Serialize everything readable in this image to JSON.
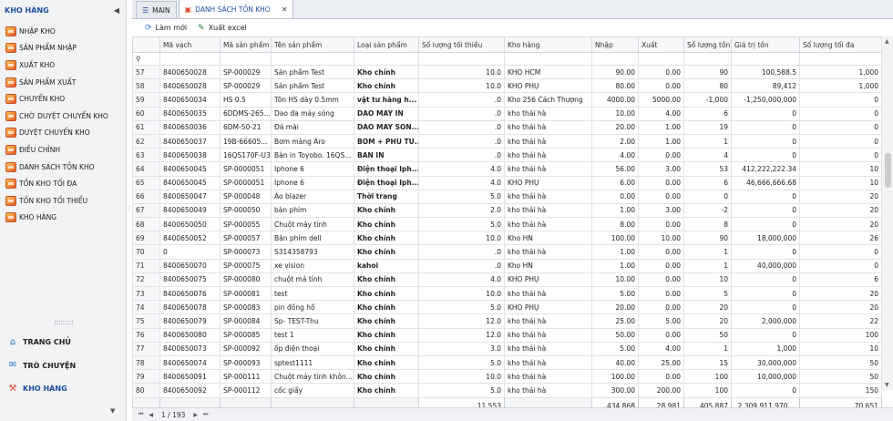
{
  "sidebar": {
    "title": "KHO HÀNG",
    "items": [
      {
        "label": "NHẬP KHO"
      },
      {
        "label": "SẢN PHẨM NHẬP"
      },
      {
        "label": "XUẤT KHO"
      },
      {
        "label": "SẢN PHẨM XUẤT"
      },
      {
        "label": "CHUYỂN KHO"
      },
      {
        "label": "CHỜ DUYỆT CHUYỂN KHO"
      },
      {
        "label": "DUYỆT CHUYỂN KHO"
      },
      {
        "label": "ĐIỀU CHỈNH"
      },
      {
        "label": "DANH SÁCH TỒN KHO"
      },
      {
        "label": "TỒN KHO TỐI ĐA"
      },
      {
        "label": "TỒN KHO TỐI THIỂU"
      },
      {
        "label": "KHO HÀNG"
      }
    ],
    "bottom": [
      {
        "label": "TRANG CHỦ",
        "icon": "home-icon"
      },
      {
        "label": "TRÒ CHUYỆN",
        "icon": "chat-icon"
      },
      {
        "label": "KHO HÀNG",
        "icon": "warehouse-icon"
      }
    ]
  },
  "tabs": [
    {
      "label": "MAIN",
      "icon": "list-icon"
    },
    {
      "label": "DANH SÁCH TỒN KHO",
      "icon": "report-icon"
    }
  ],
  "toolbar": {
    "refresh_label": "Làm mới",
    "export_label": "Xuất excel"
  },
  "columns": [
    "",
    "Mã vạch",
    "Mã sản phẩm",
    "Tên sản phẩm",
    "Loại sản phẩm",
    "Số lượng tối thiểu",
    "Kho hàng",
    "Nhập",
    "Xuất",
    "Số lượng tồn",
    "Giá trị tồn",
    "Số lượng tối đa"
  ],
  "filter_icon": "filter-icon",
  "rows": [
    [
      "57",
      "8400650028",
      "SP-000029",
      "Sản phẩm Test",
      "Kho chính",
      "10.0",
      "KHO HCM",
      "90.00",
      "0.00",
      "90",
      "100,588.5",
      "1,000"
    ],
    [
      "58",
      "8400650028",
      "SP-000029",
      "Sản phẩm Test",
      "Kho chính",
      "10.0",
      "KHO PHỤ",
      "80.00",
      "0.00",
      "80",
      "89,412",
      "1,000"
    ],
    [
      "59",
      "8400650034",
      "HS 0.5",
      "Tôn HS dày 0.5mm",
      "vật tư hàng h...",
      ".0",
      "Kho 256 Cách Thượng",
      "4000.00",
      "5000.00",
      "-1,000",
      "-1,250,000,000",
      "0"
    ],
    [
      "60",
      "8400650035",
      "6DDMS-265...",
      "Dao đa máy sóng",
      "DAO MAY IN",
      ".0",
      "kho thái hà",
      "10.00",
      "4.00",
      "6",
      "0",
      "0"
    ],
    [
      "61",
      "8400650036",
      "6DM-50-21",
      "Đá mài",
      "DAO MAY SON...",
      ".0",
      "kho thái hà",
      "20.00",
      "1.00",
      "19",
      "0",
      "0"
    ],
    [
      "62",
      "8400650037",
      "19B-66605...",
      "Bơm màng Aro",
      "BOM + PHU TU...",
      ".0",
      "kho thái hà",
      "2.00",
      "1.00",
      "1",
      "0",
      "0"
    ],
    [
      "63",
      "8400650038",
      "16QS170F-U3",
      "Bàn in Toyobo. 16QS...",
      "BAN IN",
      ".0",
      "kho thái hà",
      "4.00",
      "0.00",
      "4",
      "0",
      "0"
    ],
    [
      "64",
      "8400650045",
      "SP-0000051",
      "Iphone 6",
      "Điện thoại Iph...",
      "4.0",
      "kho thái hà",
      "56.00",
      "3.00",
      "53",
      "412,222,222.34",
      "10"
    ],
    [
      "65",
      "8400650045",
      "SP-0000051",
      "Iphone 6",
      "Điện thoại Iph...",
      "4.0",
      "KHO PHỤ",
      "6.00",
      "0.00",
      "6",
      "46,666,666.68",
      "10"
    ],
    [
      "66",
      "8400650047",
      "SP-000048",
      "Áo blazer",
      "Thời trang",
      "5.0",
      "kho thái hà",
      "0.00",
      "0.00",
      "0",
      "0",
      "20"
    ],
    [
      "67",
      "8400650049",
      "SP-000050",
      "bàn  phím",
      "Kho chính",
      "2.0",
      "kho thái hà",
      "1.00",
      "3.00",
      "-2",
      "0",
      "20"
    ],
    [
      "68",
      "8400650050",
      "SP-000055",
      "Chuột máy tính",
      "Kho chính",
      "5.0",
      "kho thái hà",
      "8.00",
      "0.00",
      "8",
      "0",
      "20"
    ],
    [
      "69",
      "8400650052",
      "SP-000057",
      "Bàn phím dell",
      "Kho chính",
      "10.0",
      "Kho HN",
      "100.00",
      "10.00",
      "90",
      "18,000,000",
      "26"
    ],
    [
      "70",
      "0",
      "SP-000073",
      "S314358793",
      "Kho chính",
      ".0",
      "kho thái hà",
      "1.00",
      "0.00",
      "1",
      "0",
      "0"
    ],
    [
      "71",
      "8400650070",
      "SP-000075",
      "xe vision",
      "kahoi",
      ".0",
      "Kho HN",
      "1.00",
      "0.00",
      "1",
      "40,000,000",
      "0"
    ],
    [
      "72",
      "8400650075",
      "SP-000080",
      "chuột mả tính",
      "Kho chính",
      "4.0",
      "KHO PHỤ",
      "10.00",
      "0.00",
      "10",
      "0",
      "6"
    ],
    [
      "73",
      "8400650076",
      "SP-000081",
      "test",
      "Kho chính",
      "10.0",
      "kho thái hà",
      "5.00",
      "0.00",
      "5",
      "0",
      "20"
    ],
    [
      "74",
      "8400650078",
      "SP-000083",
      "pin đồng hồ",
      "Kho chính",
      "5.0",
      "KHO PHỤ",
      "20.00",
      "0.00",
      "20",
      "0",
      "20"
    ],
    [
      "75",
      "8400650079",
      "SP-000084",
      "Sp- TEST-Thu",
      "Kho chính",
      "12.0",
      "kho thái hà",
      "25.00",
      "5.00",
      "20",
      "2,000,000",
      "22"
    ],
    [
      "76",
      "8400650080",
      "SP-000085",
      "test 1",
      "Kho chính",
      "12.0",
      "kho thái hà",
      "50.00",
      "0.00",
      "50",
      "0",
      "100"
    ],
    [
      "77",
      "8400650073",
      "SP-000092",
      "ốp điện thoại",
      "Kho chính",
      "3.0",
      "kho thái hà",
      "5.00",
      "4.00",
      "1",
      "1,000",
      "10"
    ],
    [
      "78",
      "8400650074",
      "SP-000093",
      "sptest1111",
      "Kho chính",
      "5.0",
      "kho thái hà",
      "40.00",
      "25.00",
      "15",
      "30,000,000",
      "50"
    ],
    [
      "79",
      "8400650091",
      "SP-000111",
      "Chuột máy tính  khôn...",
      "Kho chính",
      "10.0",
      "kho thái hà",
      "100.00",
      "0.00",
      "100",
      "10,000,000",
      "50"
    ]
  ],
  "partial_row": [
    "80",
    "8400650092",
    "SP-000112",
    "cốc giấy",
    "Kho chính",
    "5.0",
    "kho thái hà",
    "300.00",
    "200.00",
    "100",
    "0",
    "150"
  ],
  "summary": {
    "min_qty": "11,553",
    "import": "434,868",
    "export": "28,981",
    "stock": "405,887",
    "value": "2,309,911,970,...",
    "max_qty": "70,651"
  },
  "pager": {
    "text": "1 / 193"
  }
}
